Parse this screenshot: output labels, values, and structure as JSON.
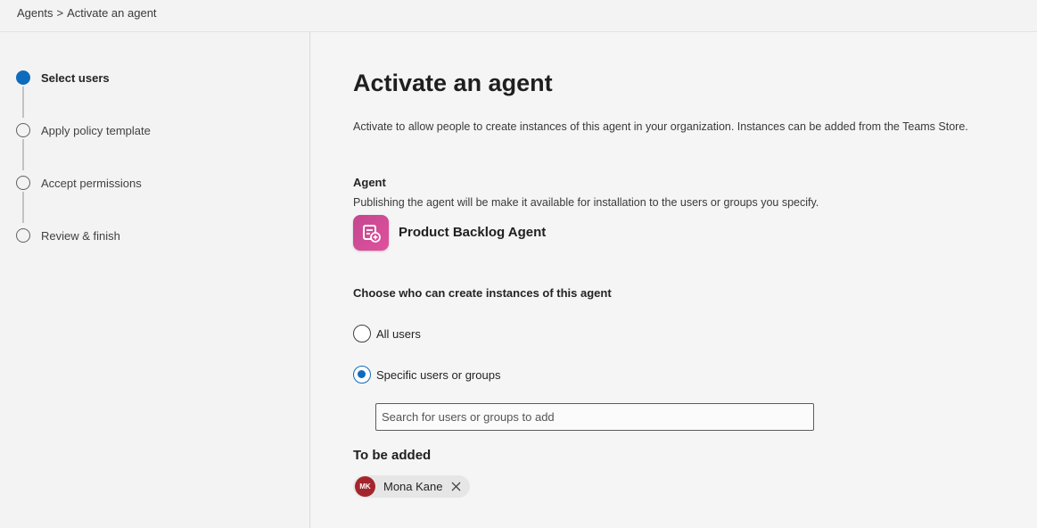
{
  "breadcrumb": {
    "root": "Agents",
    "separator": ">",
    "current": "Activate an agent"
  },
  "steps": [
    {
      "label": "Select users",
      "active": true
    },
    {
      "label": "Apply policy template",
      "active": false
    },
    {
      "label": "Accept permissions",
      "active": false
    },
    {
      "label": "Review & finish",
      "active": false
    }
  ],
  "main": {
    "title": "Activate an agent",
    "intro": "Activate to allow people to create instances of this agent in your organization. Instances can be added from the Teams Store.",
    "agent_section": {
      "label": "Agent",
      "description": "Publishing the agent will be make it available for installation to the users or groups you specify.",
      "agent_name": "Product Backlog Agent",
      "icon": "agent-app-icon"
    },
    "audience": {
      "label": "Choose who can create instances of this agent",
      "options": [
        {
          "label": "All users",
          "selected": false
        },
        {
          "label": "Specific users or groups",
          "selected": true
        }
      ],
      "search_placeholder": "Search for users or groups to add"
    },
    "to_be_added": {
      "label": "To be added",
      "people": [
        {
          "initials": "MK",
          "name": "Mona Kane"
        }
      ]
    }
  },
  "colors": {
    "accent": "#0f6cbd",
    "agent_icon": "#d44a97",
    "avatar": "#a4262c"
  }
}
